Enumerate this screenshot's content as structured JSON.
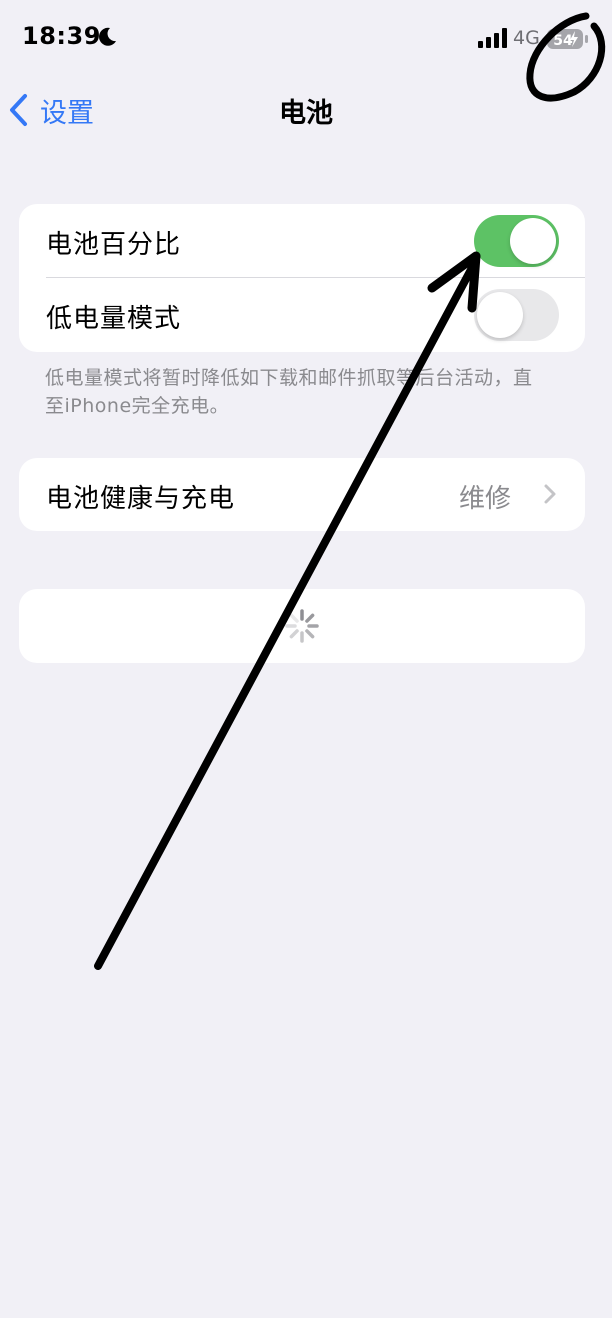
{
  "status_bar": {
    "time": "18:39",
    "network": "4G",
    "battery_level": "54",
    "moon_icon": "moon-icon",
    "signal_icon": "cellular-signal-icon",
    "battery_icon": "battery-charging-icon"
  },
  "nav": {
    "back_label": "设置",
    "back_icon": "chevron-left-icon",
    "title": "电池"
  },
  "battery_percentage": {
    "label": "电池百分比",
    "enabled": true
  },
  "low_power_mode": {
    "label": "低电量模式",
    "enabled": false,
    "footnote": "低电量模式将暂时降低如下载和邮件抓取等后台活动，直至iPhone完全充电。"
  },
  "battery_health": {
    "label": "电池健康与充电",
    "value": "维修",
    "chevron_icon": "chevron-right-icon"
  },
  "loading": {
    "icon": "spinner-icon"
  },
  "colors": {
    "background": "#f1f0f6",
    "accent": "#3478f6",
    "toggle_on": "#5dc265",
    "toggle_off": "#e8e8ea",
    "secondary_text": "#8a8a8e"
  }
}
